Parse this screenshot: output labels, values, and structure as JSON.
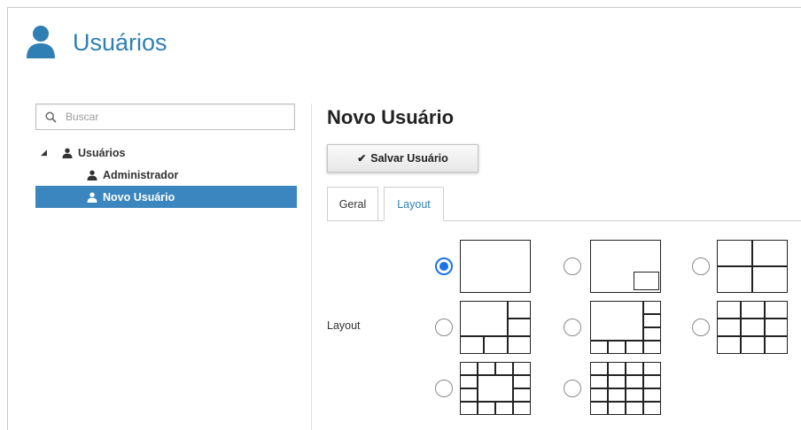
{
  "header": {
    "title": "Usuários",
    "icon": "user-icon"
  },
  "search": {
    "placeholder": "Buscar",
    "value": ""
  },
  "tree": {
    "root": {
      "label": "Usuários",
      "expanded": true
    },
    "children": [
      {
        "label": "Administrador",
        "selected": false
      },
      {
        "label": "Novo Usuário",
        "selected": true
      }
    ]
  },
  "content": {
    "title": "Novo Usuário",
    "save_label": "Salvar Usuário",
    "tabs": [
      {
        "label": "Geral",
        "active": false
      },
      {
        "label": "Layout",
        "active": true
      }
    ],
    "layout_label": "Layout",
    "layout_options": [
      {
        "name": "1 tela",
        "selected": true
      },
      {
        "name": "1+1 picture-in-picture",
        "selected": false
      },
      {
        "name": "4 telas",
        "selected": false
      },
      {
        "name": "6 telas",
        "selected": false
      },
      {
        "name": "8 telas",
        "selected": false
      },
      {
        "name": "9 telas",
        "selected": false
      },
      {
        "name": "13 telas",
        "selected": false
      },
      {
        "name": "16 telas",
        "selected": false
      }
    ]
  },
  "colors": {
    "accent": "#2f7fb5",
    "selection": "#3b86be",
    "radio": "#1a73e8"
  }
}
